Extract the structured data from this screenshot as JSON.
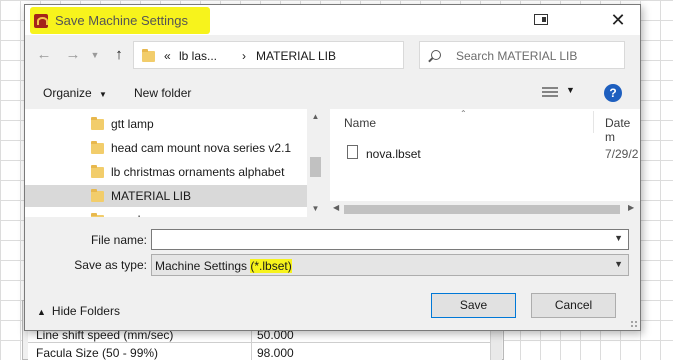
{
  "window": {
    "title": "Save Machine Settings",
    "close": "✕"
  },
  "nav": {
    "back": "←",
    "forward": "→",
    "up": "↑",
    "refresh": "↻"
  },
  "address": {
    "overflow": "«",
    "crumbs": [
      "lb las...",
      "MATERIAL LIB"
    ],
    "separator": "›"
  },
  "search": {
    "placeholder": "Search MATERIAL LIB"
  },
  "toolbar": {
    "organize": "Organize",
    "organize_caret": "▼",
    "new_folder": "New folder",
    "view_caret": "▼",
    "help": "?"
  },
  "tree": {
    "items": [
      {
        "label": "gtt lamp",
        "selected": false
      },
      {
        "label": "head cam mount nova series v2.1",
        "selected": false
      },
      {
        "label": "lb christmas ornaments alphabet",
        "selected": false
      },
      {
        "label": "MATERIAL LIB",
        "selected": true
      },
      {
        "label": "nanel",
        "selected": false
      }
    ]
  },
  "files": {
    "columns": [
      "Name",
      "Date m"
    ],
    "rows": [
      {
        "name": "nova.lbset",
        "date": "7/29/2"
      }
    ]
  },
  "form": {
    "filename_label": "File name:",
    "filename_value": "",
    "type_label": "Save as type:",
    "type_value_prefix": "Machine Settings ",
    "type_value_ext": "(*.lbset)"
  },
  "footer": {
    "hide_folders": "Hide Folders",
    "save": "Save",
    "cancel": "Cancel"
  },
  "background": {
    "rows": [
      {
        "key": "Line shift speed (mm/sec)",
        "value": "50.000"
      },
      {
        "key": "Facula Size (50 - 99%)",
        "value": "98.000"
      }
    ]
  },
  "colors": {
    "highlight": "#f7f31c",
    "help_blue": "#1e5fbf",
    "folder": "#f2cd6b"
  }
}
